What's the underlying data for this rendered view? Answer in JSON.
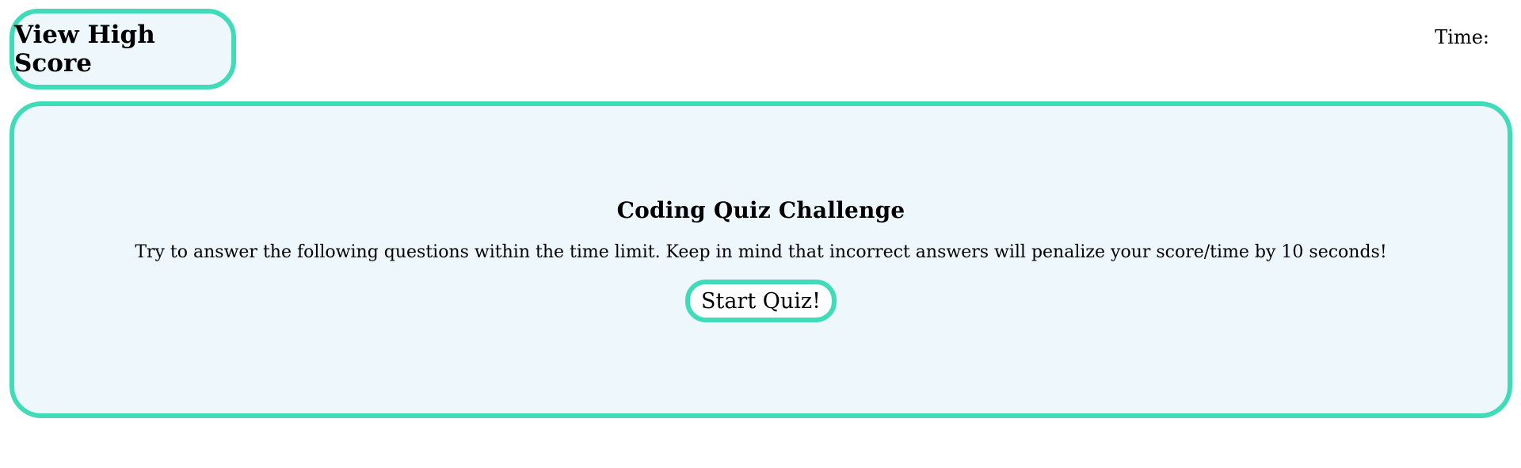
{
  "header": {
    "high_score_label": "View High Score",
    "timer_label": "Time:",
    "timer_value": ""
  },
  "quiz": {
    "title": "Coding Quiz Challenge",
    "description": "Try to answer the following questions within the time limit. Keep in mind that incorrect answers will penalize your score/time by 10 seconds!",
    "start_label": "Start Quiz!"
  },
  "colors": {
    "accent": "#40dcb9",
    "panel_background": "#eef7fc"
  }
}
